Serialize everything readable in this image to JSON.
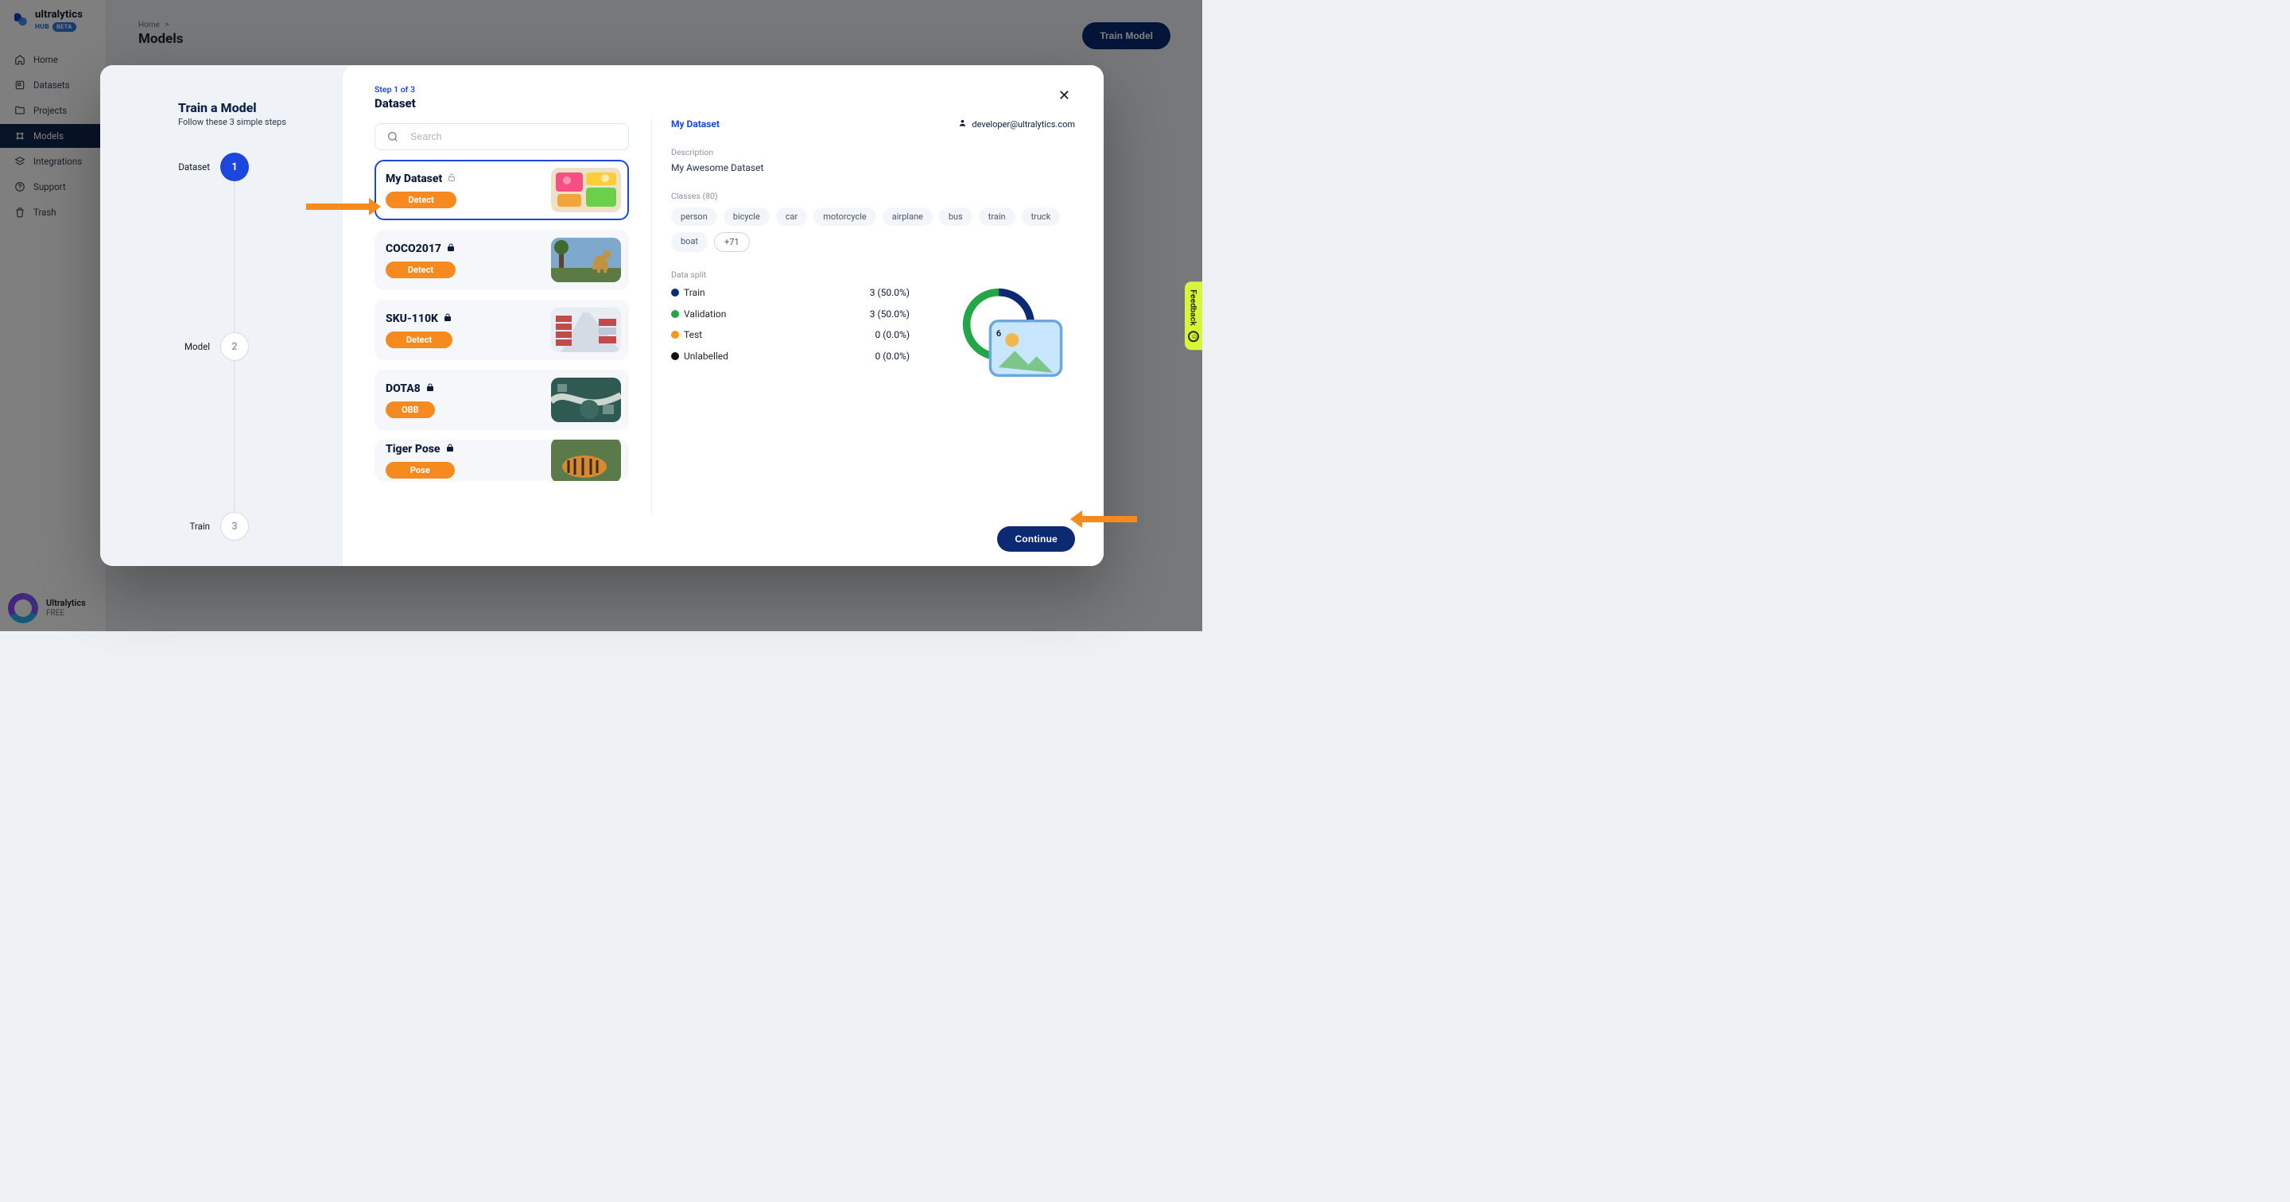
{
  "brand": {
    "name": "ultralytics",
    "subBrand": "HUB",
    "badge": "BETA"
  },
  "nav": [
    {
      "key": "home",
      "label": "Home",
      "icon": "home",
      "active": false
    },
    {
      "key": "datasets",
      "label": "Datasets",
      "icon": "square",
      "active": false
    },
    {
      "key": "projects",
      "label": "Projects",
      "icon": "folder",
      "active": false
    },
    {
      "key": "models",
      "label": "Models",
      "icon": "grid",
      "active": true
    },
    {
      "key": "integrations",
      "label": "Integrations",
      "icon": "stack",
      "active": false
    },
    {
      "key": "support",
      "label": "Support",
      "icon": "help",
      "active": false
    },
    {
      "key": "trash",
      "label": "Trash",
      "icon": "trash",
      "active": false
    }
  ],
  "user": {
    "name": "Ultralytics",
    "tier": "FREE"
  },
  "page": {
    "crumbHome": "Home",
    "crumbSep": ">",
    "title": "Models",
    "actionTrain": "Train Model"
  },
  "wizard": {
    "title": "Train a Model",
    "subtitle": "Follow these 3 simple steps",
    "steps": [
      {
        "n": "1",
        "label": "Dataset",
        "active": true
      },
      {
        "n": "2",
        "label": "Model",
        "active": false
      },
      {
        "n": "3",
        "label": "Train",
        "active": false
      }
    ]
  },
  "modal": {
    "stepCaption": "Step 1 of 3",
    "stepTitle": "Dataset",
    "searchPlaceholder": "Search",
    "continue": "Continue"
  },
  "datasets": [
    {
      "name": "My Dataset",
      "tag": "Detect",
      "selected": true,
      "lock": "open"
    },
    {
      "name": "COCO2017",
      "tag": "Detect",
      "selected": false,
      "lock": "locked"
    },
    {
      "name": "SKU-110K",
      "tag": "Detect",
      "selected": false,
      "lock": "locked"
    },
    {
      "name": "DOTA8",
      "tag": "OBB",
      "selected": false,
      "lock": "locked"
    },
    {
      "name": "Tiger Pose",
      "tag": "Pose",
      "selected": false,
      "lock": "locked"
    }
  ],
  "detail": {
    "title": "My Dataset",
    "email": "developer@ultralytics.com",
    "descLabel": "Description",
    "description": "My Awesome Dataset",
    "classesLabel": "Classes (80)",
    "classes": [
      "person",
      "bicycle",
      "car",
      "motorcycle",
      "airplane",
      "bus",
      "train",
      "truck",
      "boat"
    ],
    "classesMore": "+71",
    "splitLabel": "Data split",
    "split": [
      {
        "key": "train",
        "label": "Train",
        "count": "3 (50.0%)",
        "color": "#0b2a72"
      },
      {
        "key": "val",
        "label": "Validation",
        "count": "3 (50.0%)",
        "color": "#23a647"
      },
      {
        "key": "test",
        "label": "Test",
        "count": "0 (0.0%)",
        "color": "#f39c12"
      },
      {
        "key": "unlabelled",
        "label": "Unlabelled",
        "count": "0 (0.0%)",
        "color": "#111111"
      }
    ],
    "donutCount": "6"
  },
  "feedback": {
    "label": "Feedback"
  }
}
